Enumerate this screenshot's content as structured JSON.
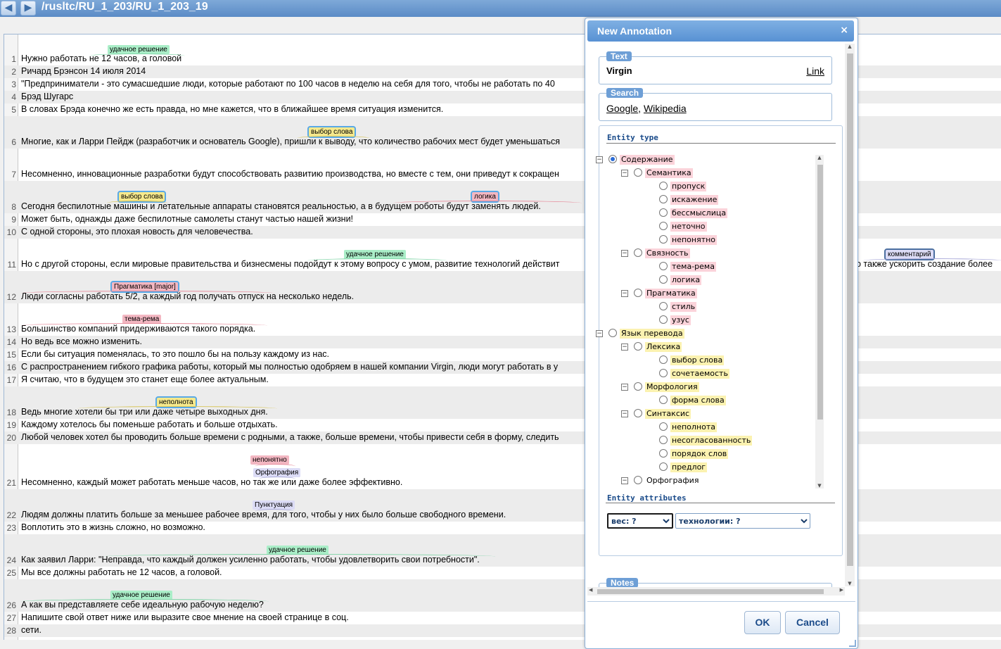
{
  "nav": {
    "back_icon": "◀",
    "forward_icon": "▶",
    "path": "/rusltc/RU_1_203/RU_1_203_19"
  },
  "document": {
    "lines": [
      {
        "n": "1",
        "text": "Нужно работать не 12 часов, а головой"
      },
      {
        "n": "2",
        "text": "Ричард Брэнсон 14 июля 2014"
      },
      {
        "n": "3",
        "text": "\"Предприниматели - это сумасшедшие люди, которые работают по 100 часов в неделю на себя для того, чтобы не работать по 40"
      },
      {
        "n": "4",
        "text": "Брэд Шугарс"
      },
      {
        "n": "5",
        "text": "В словах Брэда конечно же есть правда, но мне кажется, что в ближайшее время ситуация изменится."
      },
      {
        "n": "6",
        "text": "Многие, как и Ларри Пейдж (разработчик и основатель Google), пришли к выводу, что количество рабочих мест будет уменьшаться"
      },
      {
        "n": "7",
        "text": "Несомненно, инновационные разработки будут способствовать развитию производства, но вместе с тем, они приведут к сокращен"
      },
      {
        "n": "8",
        "text": "Сегодня беспилотные    машины     и летательные аппараты становятся реальностью, а в будущем роботы будут заменять людей."
      },
      {
        "n": "9",
        "text": "Может быть, однажды даже беспилотные самолеты станут частью нашей жизни!"
      },
      {
        "n": "10",
        "text": "С одной стороны, это плохая новость для человечества."
      },
      {
        "n": "11",
        "text": "Но с другой стороны, если мировые правительства и бизнесмены подойдут к этому вопросу с умом, развитие технологий действит"
      },
      {
        "n": "12",
        "text": "Люди согласны работать 5/2, а каждый год получать отпуск на несколько недель."
      },
      {
        "n": "13",
        "text": "Большинство компаний придерживаются такого порядка."
      },
      {
        "n": "14",
        "text": "Но ведь все можно изменить."
      },
      {
        "n": "15",
        "text": "Если бы ситуация поменялась, то это пошло бы на пользу каждому из нас."
      },
      {
        "n": "16",
        "text": "С распространением гибкого графика работы, который мы полностью одобряем в нашей компании Virgin, люди могут работать в у"
      },
      {
        "n": "17",
        "text": "Я считаю, что в будущем это станет еще более актуальным."
      },
      {
        "n": "18",
        "text": "Ведь многие хотели бы три или даже четыре выходных дня."
      },
      {
        "n": "19",
        "text": "Каждому хотелось бы поменьше работать и больше отдыхать."
      },
      {
        "n": "20",
        "text": "Любой человек хотел бы проводить больше времени с родными, а также, больше времени, чтобы привести себя в форму, следить"
      },
      {
        "n": "21",
        "text": "Несомненно, каждый может работать меньше часов, но так же     или даже более эффективно."
      },
      {
        "n": "22",
        "text": "Людям должны платить больше за меньшее рабочее    время,    для того, чтобы у них было больше свободного времени."
      },
      {
        "n": "23",
        "text": "Воплотить это в жизнь сложно, но возможно."
      },
      {
        "n": "24",
        "text": "Как заявил Ларри: \"Неправда, что каждый должен усиленно работать, чтобы удовлетворить свои потребности\"."
      },
      {
        "n": "25",
        "text": "Мы все должны работать не 12 часов, а головой."
      },
      {
        "n": "26",
        "text": "А как вы представляете себе идеальную рабочую неделю?"
      },
      {
        "n": "27",
        "text": "Напишите свой ответ ниже или выразите свое мнение на своей странице в соц."
      },
      {
        "n": "28",
        "text": "сети."
      }
    ],
    "line11_tail": "о также ускорить создание более",
    "tags": {
      "t1": "удачное решение",
      "t6": "выбор слова",
      "t8a": "выбор слова",
      "t8b": "логика",
      "t11a": "удачное решение",
      "t11b": "комментарий",
      "t12": "Прагматика [major]",
      "t13": "тема-рема",
      "t18": "неполнота",
      "t21a": "непонятно",
      "t21b": "Орфография",
      "t22": "Пунктуация",
      "t24": "удачное решение",
      "t26": "удачное решение"
    }
  },
  "dialog": {
    "title": "New Annotation",
    "close_icon": "×",
    "text_legend": "Text",
    "text_value": "Virgin",
    "link_label": "Link",
    "search_legend": "Search",
    "search_google": "Google",
    "search_sep": ",",
    "search_wikipedia": "Wikipedia",
    "entity_type_label": "Entity type",
    "tree": {
      "content": "Содержание",
      "semantics": "Семантика",
      "omission": "пропуск",
      "distortion": "искажение",
      "nonsense": "бессмыслица",
      "inaccurate": "неточно",
      "unclear": "непонятно",
      "coherence": "Связность",
      "theme_rheme": "тема-рема",
      "logic": "логика",
      "pragmatics": "Прагматика",
      "style": "стиль",
      "usage": "узус",
      "target_lang": "Язык перевода",
      "lexis": "Лексика",
      "word_choice": "выбор слова",
      "collocation": "сочетаемость",
      "morphology": "Морфология",
      "word_form": "форма слова",
      "syntax": "Синтаксис",
      "incomplete": "неполнота",
      "agreement": "несогласованность",
      "word_order": "порядок слов",
      "preposition": "предлог",
      "orthography": "Орфография"
    },
    "expand_icon": "⊟",
    "entity_attributes_label": "Entity attributes",
    "weight_select": "вес: ?",
    "tech_select": "технологии: ?",
    "notes_legend": "Notes",
    "notes_clear_icon": "×",
    "ok_label": "OK",
    "cancel_label": "Cancel",
    "scroll_up_icon": "▲",
    "scroll_down_icon": "▼",
    "scroll_left_icon": "◀",
    "scroll_right_icon": "▶"
  }
}
